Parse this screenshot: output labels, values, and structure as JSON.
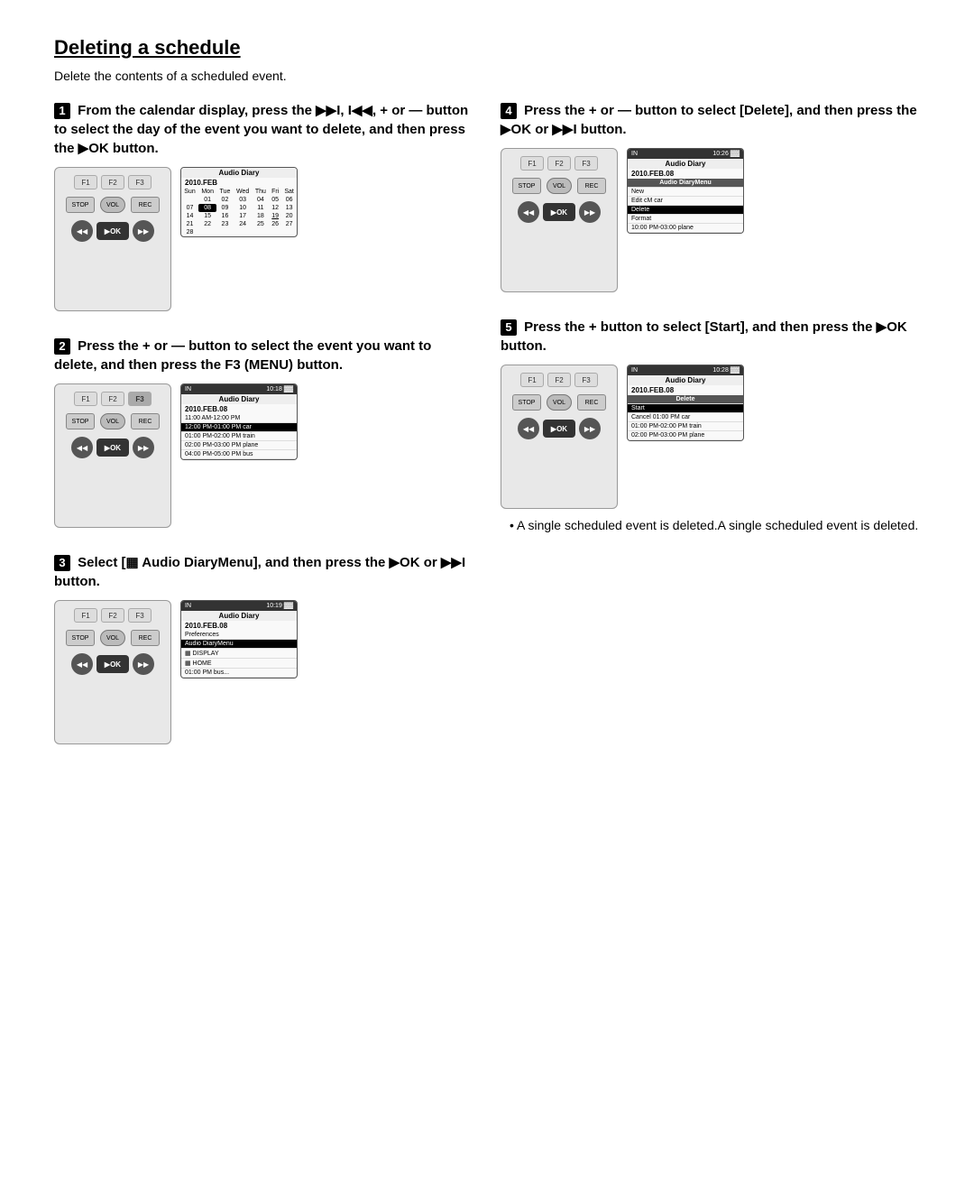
{
  "page": {
    "title": "Deleting a schedule",
    "subtitle": "Delete the contents of a scheduled event."
  },
  "steps": [
    {
      "number": "1",
      "heading": "From the calendar display, press the ▶▶I, I◀◀, + or — button to select the day of the event you want to delete, and then press the ▶OK button.",
      "screens": {
        "left": "device",
        "right": "calendar"
      }
    },
    {
      "number": "2",
      "heading": "Press the + or — button to select the event you want to delete, and then press the F3 (MENU) button.",
      "screens": {
        "left": "device",
        "right": "events"
      }
    },
    {
      "number": "3",
      "heading": "Select [▦ Audio DiaryMenu], and then press the ▶OK or ▶▶I button.",
      "screens": {
        "left": "device",
        "right": "menu1"
      }
    },
    {
      "number": "4",
      "heading": "Press the + or — button to select [Delete], and then press the ▶OK or ▶▶I button.",
      "screens": {
        "left": "device",
        "right": "menu2"
      }
    },
    {
      "number": "5",
      "heading": "Press the + button to select [Start], and then press the ▶OK button.",
      "screens": {
        "left": "device",
        "right": "menu3"
      },
      "note": "A single scheduled event is deleted."
    }
  ],
  "labels": {
    "f1": "F1",
    "f2": "F2",
    "f3": "F3",
    "stop": "STOP",
    "vol": "VOL",
    "rec": "REC",
    "ok": "▶OK",
    "prev": "I◀◀",
    "next": "▶▶I",
    "audio_diary": "Audio Diary",
    "date1": "2010.FEB",
    "date2": "2010.FEB.08",
    "in": "IN",
    "time1": "10:18",
    "time2": "10:19",
    "time3": "10:26",
    "time4": "10:28",
    "battery": "▓▓▓",
    "cal_header": "Sun Mon Tue Wed Thu Fri Sat",
    "cal_row1": "01 02 03 04 05 06",
    "cal_row2": "07  08  09 10 11 12 13",
    "cal_row3": "14 15 16 17 18 19 20",
    "cal_row4": "21 22 23 24 25 26 27",
    "cal_row5": "28",
    "events": [
      "11:00 AM-12:00 PM",
      "12:00 PM-01:00 PM car",
      "01:00 PM-02:00 PM train",
      "02:00 PM-03:00 PM plane",
      "04:00 PM-05:00 PM bus"
    ],
    "menu_preferences": "Preferences",
    "menu_audiodiary": "Audio DiaryMenu",
    "menu_display": "▦ DISPLAY",
    "menu_home": "▦ HOME",
    "menu_new": "New",
    "menu_edit": "Edit",
    "menu_delete": "Delete",
    "menu_format": "Format",
    "start_label": "Start",
    "cancel_label": "Cancel",
    "delete_label": "Delete",
    "event1": "01:00 PM-01:00 car",
    "event2": "01:00 PM-02:00 PM train",
    "event3": "02:00 PM-03:00 PM plane"
  }
}
